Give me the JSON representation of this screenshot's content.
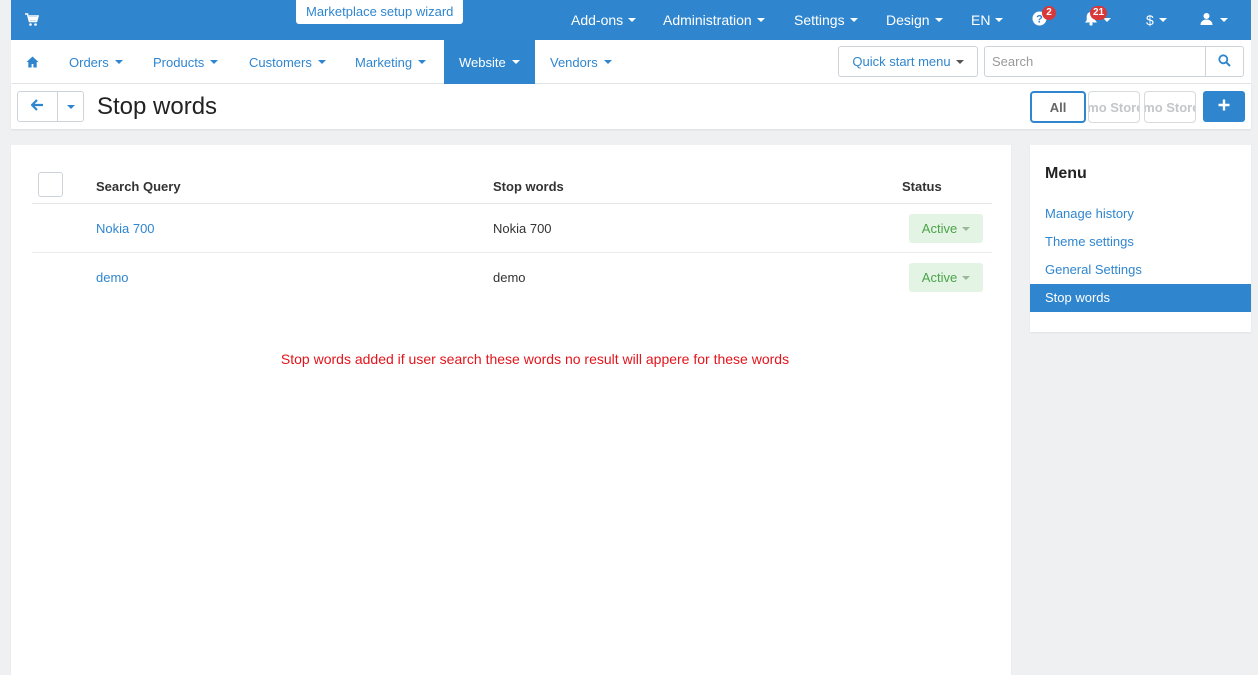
{
  "topbar": {
    "wizard": "Marketplace setup wizard",
    "addons": "Add-ons",
    "administration": "Administration",
    "settings": "Settings",
    "design": "Design",
    "language": "EN",
    "help_badge": "2",
    "notifications_badge": "21",
    "currency": "$"
  },
  "subnav": {
    "items": [
      "Orders",
      "Products",
      "Customers",
      "Marketing",
      "Website",
      "Vendors"
    ],
    "active": "Website",
    "quickstart": "Quick start menu",
    "search_placeholder": "Search"
  },
  "page": {
    "title": "Stop words",
    "store_buttons": [
      "All",
      "Demo Store",
      "Demo Store"
    ]
  },
  "table": {
    "headers": {
      "query": "Search Query",
      "words": "Stop words",
      "status": "Status"
    },
    "rows": [
      {
        "query": "Nokia 700",
        "words": "Nokia 700",
        "status": "Active"
      },
      {
        "query": "demo",
        "words": "demo",
        "status": "Active"
      }
    ]
  },
  "notice": "Stop words added if user search these words no result will appere for these words",
  "sidemenu": {
    "title": "Menu",
    "items": [
      "Manage history",
      "Theme settings",
      "General Settings",
      "Stop words"
    ],
    "active": "Stop words"
  },
  "colors": {
    "primary": "#2f86cf",
    "active_status_bg": "#e4f4e4",
    "active_status_text": "#4aa34a",
    "notice": "#e3141b"
  }
}
